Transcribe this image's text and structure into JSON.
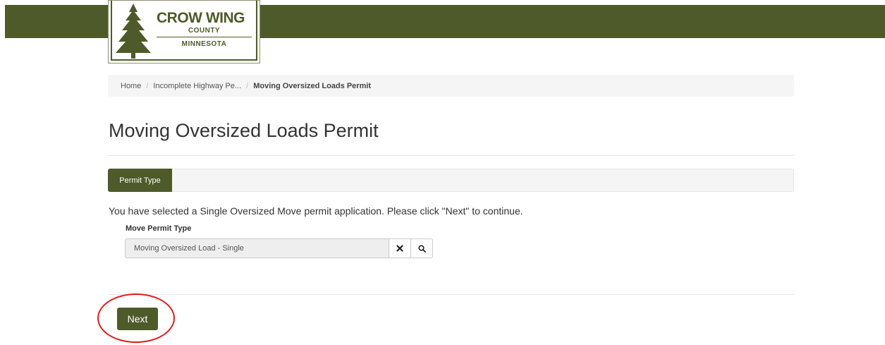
{
  "header": {
    "logo": {
      "line1": "CROW WING",
      "line2": "COUNTY",
      "line3": "MINNESOTA"
    },
    "colors": {
      "brand": "#4e5a2a"
    }
  },
  "breadcrumb": {
    "items": [
      "Home",
      "Incomplete Highway Pe..."
    ],
    "separator": "/",
    "current": "Moving Oversized Loads Permit"
  },
  "page": {
    "title": "Moving Oversized Loads Permit"
  },
  "tabs": [
    {
      "label": "Permit Type",
      "active": true
    }
  ],
  "form": {
    "intro_text": "You have selected a Single Oversized Move permit application. Please click \"Next\" to continue.",
    "move_permit_type": {
      "label": "Move Permit Type",
      "value": "Moving Oversized Load - Single",
      "clear_icon": "close-icon",
      "search_icon": "search-icon"
    }
  },
  "actions": {
    "next_label": "Next"
  },
  "annotation": {
    "ring_color": "#dd1c1c"
  }
}
